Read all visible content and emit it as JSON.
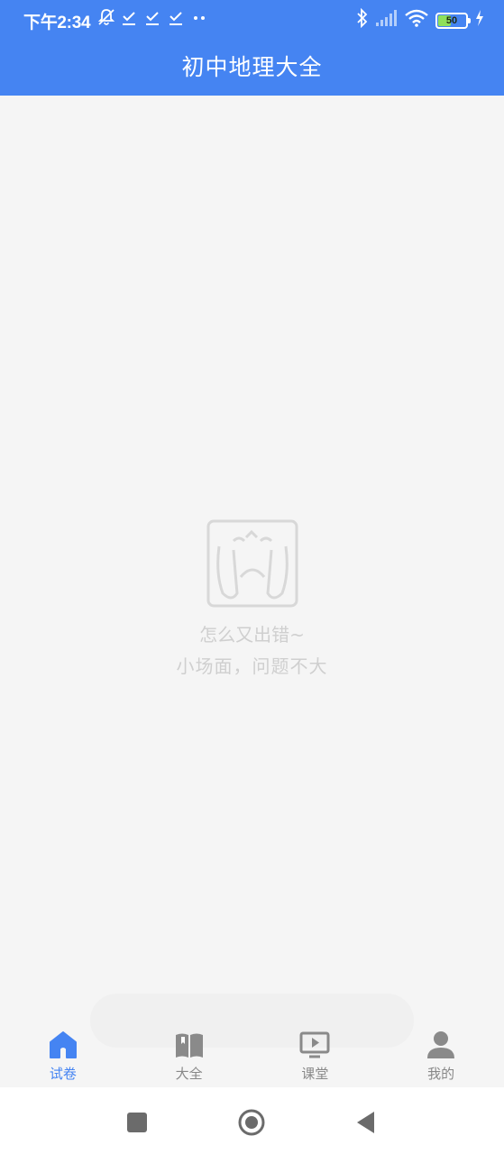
{
  "status_bar": {
    "time": "下午2:34",
    "left_icons": [
      "notification-muted-icon",
      "download-done-icon",
      "download-done-icon",
      "download-done-icon",
      "more-dots-icon"
    ],
    "right_icons": [
      "bluetooth-icon",
      "signal-icon",
      "wifi-icon",
      "battery-icon",
      "charging-icon"
    ],
    "battery_level": "50",
    "battery_fraction": 0.5
  },
  "header": {
    "title": "初中地理大全"
  },
  "error_state": {
    "illustration": "crying-face-illustration",
    "line1": "怎么又出错~",
    "line2": "小场面，问题不大"
  },
  "tabs": [
    {
      "label": "试卷",
      "icon": "home-icon",
      "active": true
    },
    {
      "label": "大全",
      "icon": "book-icon",
      "active": false
    },
    {
      "label": "课堂",
      "icon": "video-play-icon",
      "active": false
    },
    {
      "label": "我的",
      "icon": "person-icon",
      "active": false
    }
  ],
  "nav_bar": {
    "buttons": [
      "recents-square-icon",
      "home-circle-icon",
      "back-triangle-icon"
    ]
  },
  "colors": {
    "primary": "#4584f2",
    "inactive": "#888888",
    "background": "#f5f5f5"
  }
}
